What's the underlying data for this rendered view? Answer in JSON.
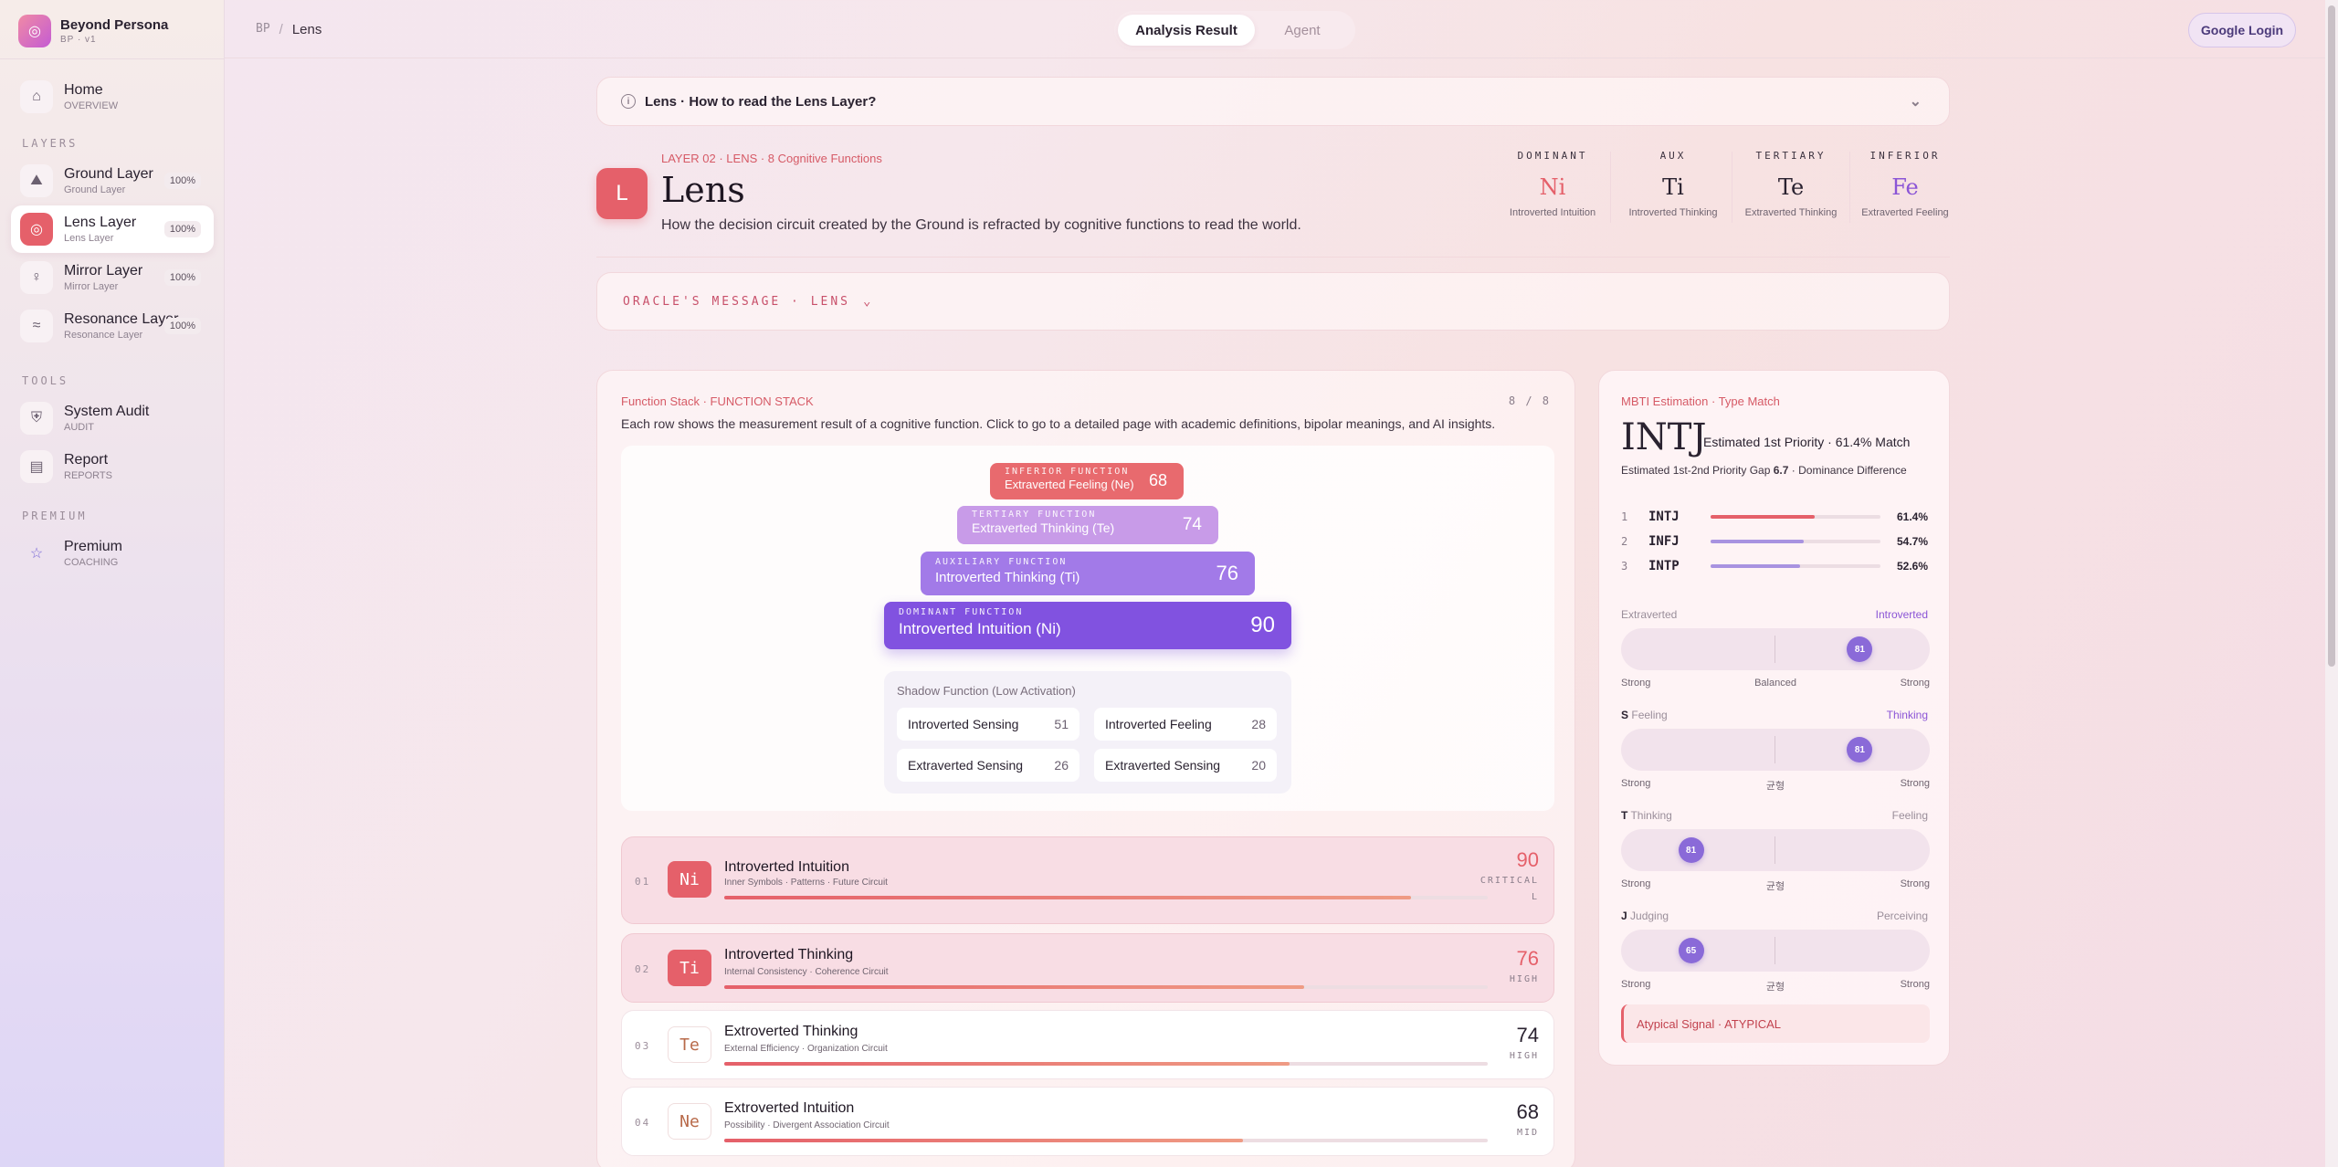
{
  "brand": {
    "name": "Beyond Persona",
    "sub": "BP · v1"
  },
  "sidebar": {
    "home": {
      "title": "Home",
      "sub": "OVERVIEW",
      "icon": "home-icon"
    },
    "layers_label": "LAYERS",
    "layers": [
      {
        "title": "Ground Layer",
        "sub": "Ground Layer",
        "pct": "100%",
        "icon": "mountain-icon"
      },
      {
        "title": "Lens Layer",
        "sub": "Lens Layer",
        "pct": "100%",
        "icon": "lens-icon",
        "active": true
      },
      {
        "title": "Mirror Layer",
        "sub": "Mirror Layer",
        "pct": "100%",
        "icon": "mirror-icon"
      },
      {
        "title": "Resonance Layer",
        "sub": "Resonance Layer",
        "pct": "100%",
        "icon": "wave-icon"
      }
    ],
    "tools_label": "TOOLS",
    "tools": [
      {
        "title": "System Audit",
        "sub": "AUDIT",
        "icon": "shield-icon"
      },
      {
        "title": "Report",
        "sub": "REPORTS",
        "icon": "document-icon"
      }
    ],
    "premium_label": "PREMIUM",
    "premium": {
      "title": "Premium",
      "sub": "COACHING",
      "icon": "star-icon"
    }
  },
  "topbar": {
    "breadcrumb_root": "BP",
    "breadcrumb_sep": "/",
    "breadcrumb_page": "Lens",
    "tab_analysis": "Analysis Result",
    "tab_agent": "Agent",
    "login": "Google Login"
  },
  "howto": {
    "text": "Lens · How to read the Lens Layer?"
  },
  "header": {
    "badge": "L",
    "kicker": "LAYER 02 · LENS · 8 Cognitive Functions",
    "title": "Lens",
    "desc": "How the decision circuit created by the Ground is refracted by cognitive functions to read the world."
  },
  "top_functions": [
    {
      "label": "DOMINANT",
      "code": "Ni",
      "sub": "Introverted Intuition",
      "color": "#e5606a"
    },
    {
      "label": "AUX",
      "code": "Ti",
      "sub": "Introverted Thinking",
      "color": "#2a2230"
    },
    {
      "label": "TERTIARY",
      "code": "Te",
      "sub": "Extraverted Thinking",
      "color": "#2a2230"
    },
    {
      "label": "INFERIOR",
      "code": "Fe",
      "sub": "Extraverted Feeling",
      "color": "#8b55d6"
    }
  ],
  "oracle": {
    "text": "ORACLE'S MESSAGE · LENS"
  },
  "stack": {
    "kicker": "Function Stack · FUNCTION STACK",
    "count": "8 / 8",
    "desc": "Each row shows the measurement result of a cognitive function. Click to go to a detailed page with academic definitions, bipolar meanings, and AI insights.",
    "pyramid": [
      {
        "kind": "INFERIOR FUNCTION",
        "name": "Extraverted Feeling (Ne)",
        "value": "68"
      },
      {
        "kind": "TERTIARY FUNCTION",
        "name": "Extraverted Thinking (Te)",
        "value": "74"
      },
      {
        "kind": "AUXILIARY FUNCTION",
        "name": "Introverted Thinking (Ti)",
        "value": "76"
      },
      {
        "kind": "DOMINANT FUNCTION",
        "name": "Introverted Intuition (Ni)",
        "value": "90"
      }
    ],
    "shadow_title": "Shadow Function (Low Activation)",
    "shadow": [
      {
        "name": "Introverted Sensing",
        "value": "51"
      },
      {
        "name": "Introverted Feeling",
        "value": "28"
      },
      {
        "name": "Extraverted Sensing",
        "value": "26"
      },
      {
        "name": "Extraverted Sensing",
        "value": "20"
      }
    ],
    "rows": [
      {
        "idx": "01",
        "code": "Ni",
        "name": "Introverted Intuition",
        "sub": "Inner Symbols · Patterns · Future Circuit",
        "score": "90",
        "level": "CRITICAL",
        "extra": "L",
        "fill": 0.9,
        "style": "hl",
        "score_color": "#e5606a"
      },
      {
        "idx": "02",
        "code": "Ti",
        "name": "Introverted Thinking",
        "sub": "Internal Consistency · Coherence Circuit",
        "score": "76",
        "level": "HIGH",
        "extra": "",
        "fill": 0.76,
        "style": "hl",
        "score_color": "#e5606a"
      },
      {
        "idx": "03",
        "code": "Te",
        "name": "Extroverted Thinking",
        "sub": "External Efficiency · Organization Circuit",
        "score": "74",
        "level": "HIGH",
        "extra": "",
        "fill": 0.74,
        "style": "plain",
        "score_color": "#1e1622"
      },
      {
        "idx": "04",
        "code": "Ne",
        "name": "Extroverted Intuition",
        "sub": "Possibility · Divergent Association Circuit",
        "score": "68",
        "level": "MID",
        "extra": "",
        "fill": 0.68,
        "style": "plain",
        "score_color": "#1e1622"
      }
    ]
  },
  "mbti": {
    "kicker": "MBTI Estimation · Type Match",
    "type": "INTJ",
    "priority": "Estimated 1st Priority · 61.4% Match",
    "gap_label": "Estimated 1st-2nd Priority Gap",
    "gap_value": "6.7",
    "gap_suffix": "· Dominance Difference",
    "ranking": [
      {
        "n": "1",
        "type": "INTJ",
        "pct": "61.4%",
        "fill": 0.614,
        "color": "#e5606a"
      },
      {
        "n": "2",
        "type": "INFJ",
        "pct": "54.7%",
        "fill": 0.547,
        "color": "#a892e0"
      },
      {
        "n": "3",
        "type": "INTP",
        "pct": "52.6%",
        "fill": 0.526,
        "color": "#a892e0"
      }
    ],
    "axes": [
      {
        "left": "Extraverted",
        "left_letter": "",
        "right": "Introverted",
        "right_active": true,
        "dot": "81",
        "position": 0.81,
        "foot_left": "Strong",
        "foot_mid": "Balanced",
        "foot_right": "Strong"
      },
      {
        "left": "Feeling",
        "left_letter": "S",
        "right": "Thinking",
        "right_active": true,
        "dot": "81",
        "position": 0.81,
        "foot_left": "Strong",
        "foot_mid": "균형",
        "foot_right": "Strong"
      },
      {
        "left": "Thinking",
        "left_letter": "T",
        "right": "Feeling",
        "right_active": false,
        "dot": "81",
        "position": 0.19,
        "foot_left": "Strong",
        "foot_mid": "균형",
        "foot_right": "Strong"
      },
      {
        "left": "Judging",
        "left_letter": "J",
        "right": "Perceiving",
        "right_active": false,
        "dot": "65",
        "position": 0.19,
        "foot_left": "Strong",
        "foot_mid": "균형",
        "foot_right": "Strong"
      }
    ],
    "atypical": "Atypical Signal · ATYPICAL"
  }
}
